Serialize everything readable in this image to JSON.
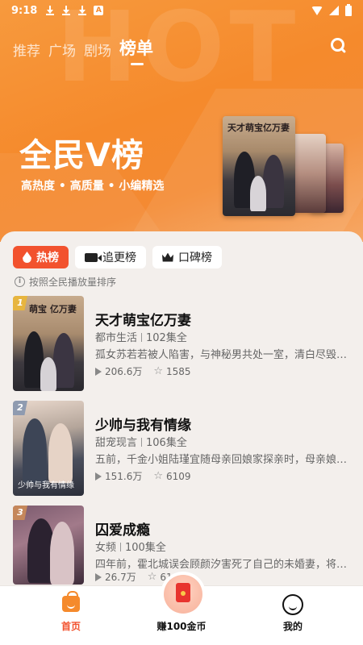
{
  "status_bar": {
    "time": "9:18"
  },
  "top_tabs": [
    "推荐",
    "广场",
    "剧场",
    "榜单"
  ],
  "active_tab_index": 3,
  "hero": {
    "title": "全民V榜",
    "subtitle": "高热度 • 高质量 • 小编精选",
    "cover_text": "天才萌宝亿万妻"
  },
  "chips": [
    {
      "label": "热榜",
      "icon": "flame-icon",
      "active": true
    },
    {
      "label": "追更榜",
      "icon": "video-icon",
      "active": false
    },
    {
      "label": "口碑榜",
      "icon": "crown-icon",
      "active": false
    }
  ],
  "sort_note": "按照全民播放量排序",
  "items": [
    {
      "rank": "1",
      "title": "天才萌宝亿万妻",
      "genre": "都市生活",
      "episodes": "102集全",
      "desc": "孤女苏若若被人陷害，与神秘男共处一室，清白尽毁。你...",
      "plays": "206.6万",
      "likes": "1585",
      "thumb_text": "萌宝 亿万妻"
    },
    {
      "rank": "2",
      "title": "少帅与我有情缘",
      "genre": "甜宠现言",
      "episodes": "106集全",
      "desc": "五前，千金小姐陆瑾宜随母亲回娘家探亲时，母亲娘家惨...",
      "plays": "151.6万",
      "likes": "6109",
      "thumb_text": "少帅与我有情缘"
    },
    {
      "rank": "3",
      "title": "囚爱成瘾",
      "genre": "女频",
      "episodes": "100集全",
      "desc": "四年前，霍北城误会顾颜汐害死了自己的未婚妻，将顾颜...",
      "plays": "26.7万",
      "likes": "61",
      "thumb_text": ""
    }
  ],
  "bottom_nav": {
    "home": "首页",
    "earn": "赚100金币",
    "mine": "我的"
  },
  "colors": {
    "accent": "#f2522e",
    "hero": "#f58a2c"
  }
}
